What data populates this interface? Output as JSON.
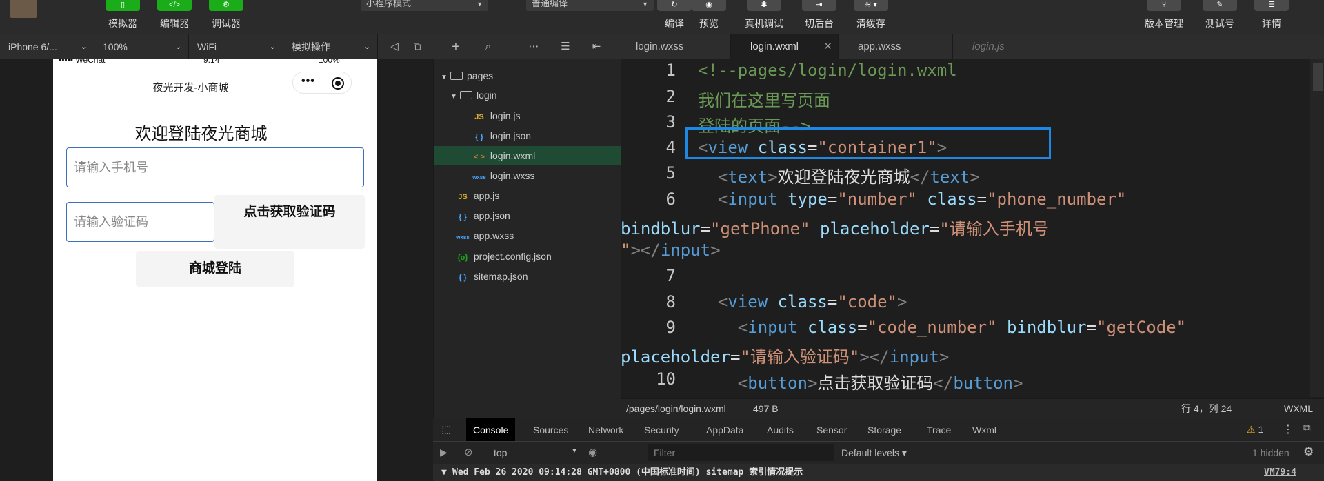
{
  "toolbar": {
    "simulator": "模拟器",
    "editor": "编辑器",
    "debugger": "调试器",
    "mode": "小程序模式",
    "compile_mode": "普通编译",
    "compile": "编译",
    "preview": "预览",
    "device_debug": "真机调试",
    "background": "切后台",
    "clear_cache": "清缓存",
    "version": "版本管理",
    "test_account": "测试号",
    "details": "详情"
  },
  "subbar": {
    "device": "iPhone 6/...",
    "zoom": "100%",
    "network": "WiFi",
    "sim_ops": "模拟操作"
  },
  "tabs": [
    {
      "label": "login.wxss"
    },
    {
      "label": "login.wxml"
    },
    {
      "label": "app.wxss"
    },
    {
      "label": "login.js"
    }
  ],
  "phone": {
    "carrier": "••••• WeChat",
    "time": "9:14",
    "battery": "100%",
    "nav_title": "夜光开发-小商城",
    "welcome": "欢迎登陆夜光商城",
    "phone_placeholder": "请输入手机号",
    "code_placeholder": "请输入验证码",
    "get_code": "点击获取验证码",
    "login": "商城登陆"
  },
  "tree": [
    {
      "label": "pages",
      "type": "folder"
    },
    {
      "label": "login",
      "type": "folder"
    },
    {
      "label": "login.js",
      "icon": "JS"
    },
    {
      "label": "login.json",
      "icon": "{ }"
    },
    {
      "label": "login.wxml",
      "icon": "< >"
    },
    {
      "label": "login.wxss",
      "icon": "wxss"
    },
    {
      "label": "app.js",
      "icon": "JS"
    },
    {
      "label": "app.json",
      "icon": "{ }"
    },
    {
      "label": "app.wxss",
      "icon": "wxss"
    },
    {
      "label": "project.config.json",
      "icon": "{o}"
    },
    {
      "label": "sitemap.json",
      "icon": "{ }"
    }
  ],
  "line_numbers": [
    "1",
    "2",
    "3",
    "4",
    "5",
    "6",
    "7",
    "8",
    "9",
    "10"
  ],
  "code": {
    "l1": "<!--pages/login/login.wxml",
    "l2": "我们在这里写页面",
    "l3": "登陆的页面-->",
    "l4_tag": "view",
    "l4_attr": "class",
    "l4_val": "\"container1\"",
    "l5_tag": "text",
    "l5_text": "欢迎登陆夜光商城",
    "l6_tag": "input",
    "l6_attr1": "type",
    "l6_val1": "\"number\"",
    "l6_attr2": "class",
    "l6_val2": "\"phone_number\"",
    "l6b_attr": "bindblur",
    "l6b_val": "\"getPhone\"",
    "l6b_attr2": "placeholder",
    "l6b_val2": "\"请输入手机号",
    "l6c": "\"",
    "l8_tag": "view",
    "l8_attr": "class",
    "l8_val": "\"code\"",
    "l9_tag": "input",
    "l9_attr1": "class",
    "l9_val1": "\"code_number\"",
    "l9_attr2": "bindblur",
    "l9_val2": "\"getCode\"",
    "l9b_attr": "placeholder",
    "l9b_val": "\"请输入验证码\"",
    "l10_tag": "button",
    "l10_text": "点击获取验证码"
  },
  "pathbar": {
    "path": "/pages/login/login.wxml",
    "size": "497 B",
    "position": "行 4，列 24",
    "language": "WXML"
  },
  "devtools": {
    "tabs": [
      "Console",
      "Sources",
      "Network",
      "Security",
      "AppData",
      "Audits",
      "Sensor",
      "Storage",
      "Trace",
      "Wxml"
    ],
    "warnings": "1",
    "context": "top",
    "filter_placeholder": "Filter",
    "levels": "Default levels",
    "hidden": "1 hidden",
    "log": "Wed Feb 26 2020 09:14:28 GMT+0800 (中国标准时间) sitemap 索引情况提示",
    "log_source": "VM79:4"
  },
  "colors": {
    "accent": "#1aad19",
    "highlight": "#1e88e5"
  }
}
